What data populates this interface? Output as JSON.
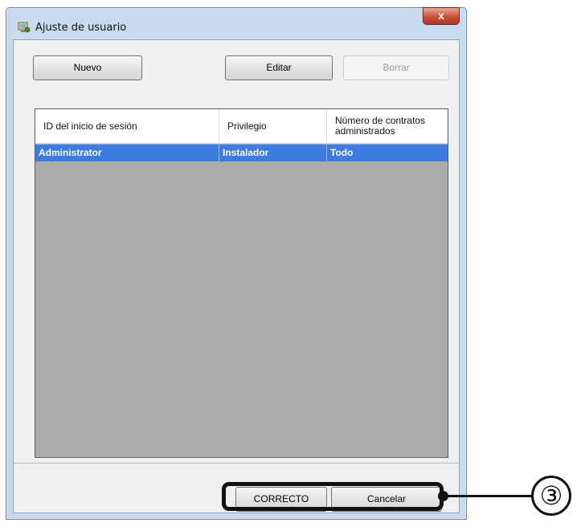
{
  "window": {
    "title": "Ajuste de usuario",
    "close_label": "x"
  },
  "toolbar": {
    "new_label": "Nuevo",
    "edit_label": "Editar",
    "delete_label": "Borrar"
  },
  "table": {
    "columns": [
      "ID del inicio de sesión",
      "Privilegio",
      "Número de contratos administrados"
    ],
    "rows": [
      [
        "Administrator",
        "Instalador",
        "Todo"
      ]
    ],
    "selected_row": 0
  },
  "footer": {
    "ok_label": "CORRECTO",
    "cancel_label": "Cancelar"
  },
  "callout": {
    "number": "③"
  },
  "colors": {
    "selection": "#3d7be0",
    "list_background": "#ababab",
    "close_button": "#c9503a"
  }
}
